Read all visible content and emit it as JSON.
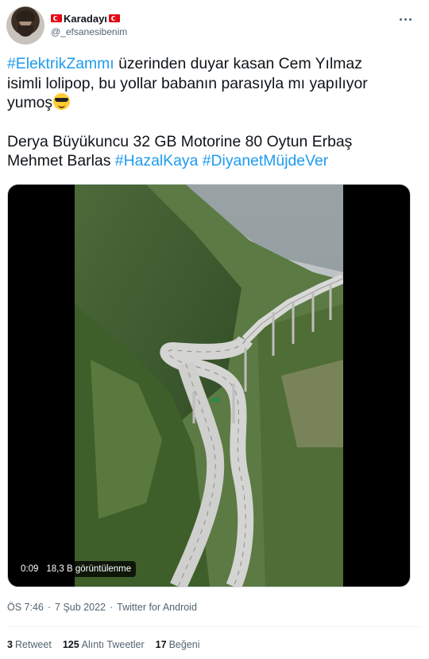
{
  "author": {
    "name": "Karadayı",
    "handle": "@_efsanesibenim"
  },
  "tweet": {
    "line1_tag": "#ElektrikZammı",
    "line1_text": " üzerinden duyar kasan Cem Yılmaz",
    "line2_text": "isimli lolipop, bu yollar babanın parasıyla mı yapılıyor",
    "line3_text": "yumoş",
    "emoji": "smiling-face-with-sunglasses",
    "line4_text": "Derya Büyükuncu 32 GB Motorine 80 Oytun Erbaş",
    "line5_text": "Mehmet Barlas ",
    "tag2": "#HazalKaya",
    "tag3": "#DiyanetMüjdeVer"
  },
  "video": {
    "duration": "0:09",
    "views": "18,3 B görüntülenme"
  },
  "meta": {
    "time": "ÖS 7:46",
    "separator": "·",
    "date": "7 Şub 2022",
    "source": "Twitter for Android"
  },
  "stats": {
    "retweets_count": "3",
    "retweets_label": "Retweet",
    "quotes_count": "125",
    "quotes_label": "Alıntı Tweetler",
    "likes_count": "17",
    "likes_label": "Beğeni"
  },
  "colors": {
    "link": "#1d9bf0",
    "secondary_text": "#536471",
    "flag_red": "#e30a17"
  }
}
